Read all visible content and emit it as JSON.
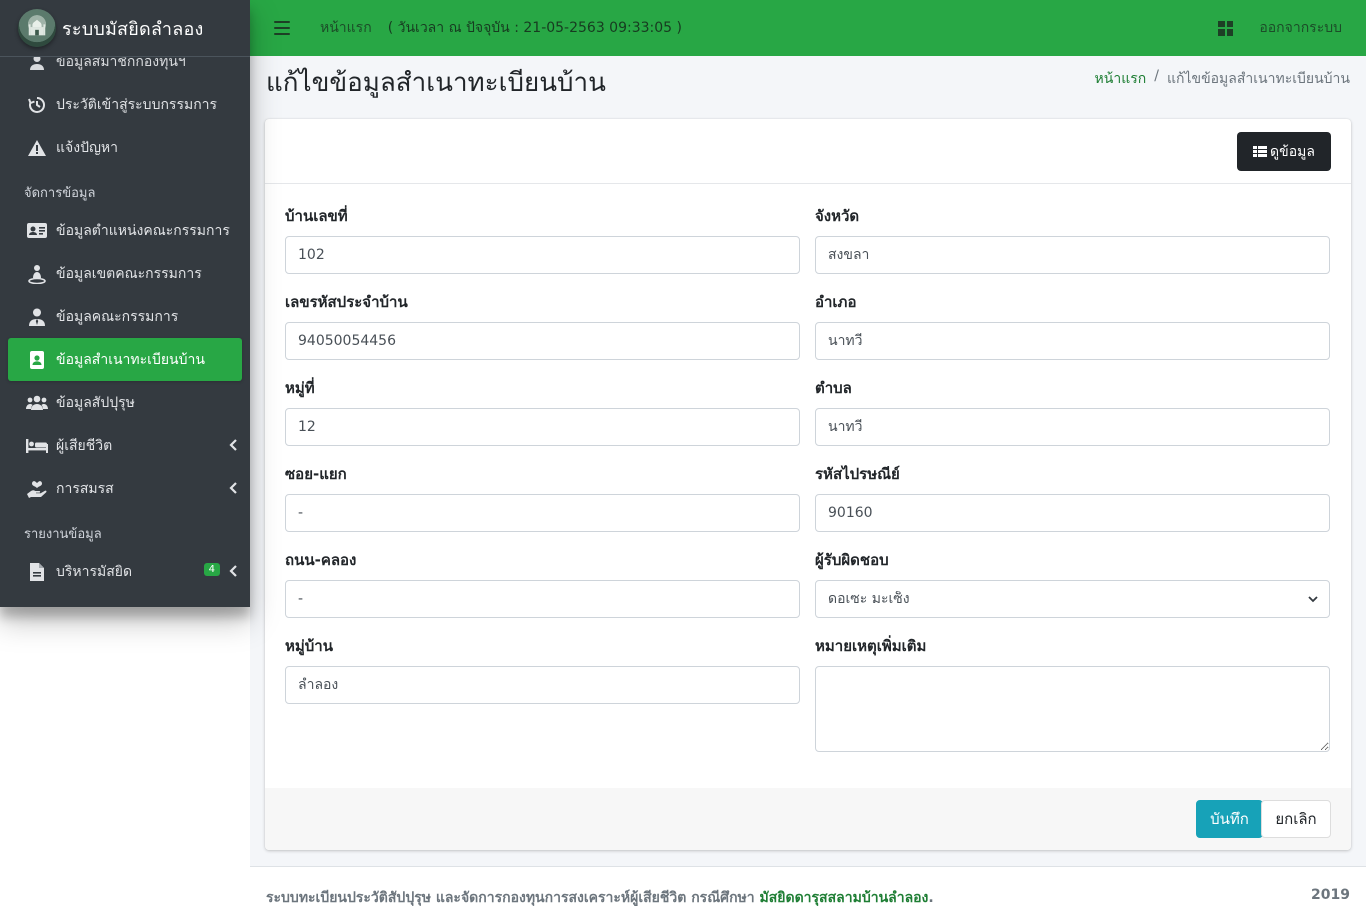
{
  "app": {
    "title": "ระบบมัสยิดลำลอง"
  },
  "sidebar": {
    "items_top": [
      {
        "label": "ข้อมูลสมาชิกกองทุนฯ",
        "icon": "user-icon"
      },
      {
        "label": "ประวัติเข้าสู่ระบบกรรมการ",
        "icon": "history-icon"
      },
      {
        "label": "แจ้งปัญหา",
        "icon": "warning-icon"
      }
    ],
    "header_manage": "จัดการข้อมูล",
    "items_manage": [
      {
        "label": "ข้อมูลตำแหน่งคณะกรรมการ",
        "icon": "id-card-icon"
      },
      {
        "label": "ข้อมูลเขตคณะกรรมการ",
        "icon": "map-marker-user-icon"
      },
      {
        "label": "ข้อมูลคณะกรรมการ",
        "icon": "user-tie-icon"
      },
      {
        "label": "ข้อมูลสำเนาทะเบียนบ้าน",
        "icon": "address-book-icon",
        "active": true
      },
      {
        "label": "ข้อมูลสัปปุรุษ",
        "icon": "users-icon"
      },
      {
        "label": "ผู้เสียชีวิต",
        "icon": "bed-icon",
        "caret": true
      },
      {
        "label": "การสมรส",
        "icon": "hand-holding-heart-icon",
        "caret": true
      }
    ],
    "header_report": "รายงานข้อมูล",
    "items_report": [
      {
        "label": "บริหารมัสยิด",
        "icon": "file-icon",
        "badge": "4",
        "caret": true
      }
    ]
  },
  "topbar": {
    "home": "หน้าแรก",
    "datetime": "( วันเวลา ณ ปัจจุบัน : 21-05-2563 09:33:05 )",
    "logout": "ออกจากระบบ"
  },
  "page": {
    "title": "แก้ไขข้อมูลสำเนาทะเบียนบ้าน",
    "breadcrumb_home": "หน้าแรก",
    "breadcrumb_current": "แก้ไขข้อมูลสำเนาทะเบียนบ้าน",
    "view_button": "ดูข้อมูล"
  },
  "form": {
    "house_no": {
      "label": "บ้านเลขที่",
      "value": "102"
    },
    "house_code": {
      "label": "เลขรหัสประจำบ้าน",
      "value": "94050054456"
    },
    "moo": {
      "label": "หมู่ที่",
      "value": "12"
    },
    "soi": {
      "label": "ซอย-แยก",
      "value": "-"
    },
    "road": {
      "label": "ถนน-คลอง",
      "value": "-"
    },
    "village": {
      "label": "หมู่บ้าน",
      "value": "ลำลอง"
    },
    "province": {
      "label": "จังหวัด",
      "value": "สงขลา"
    },
    "district": {
      "label": "อำเภอ",
      "value": "นาทวี"
    },
    "subdistrict": {
      "label": "ตำบล",
      "value": "นาทวี"
    },
    "postcode": {
      "label": "รหัสไปรษณีย์",
      "value": "90160"
    },
    "responsible": {
      "label": "ผู้รับผิดชอบ",
      "value": "ดอเซะ มะเซ็ง"
    },
    "note": {
      "label": "หมายเหตุเพิ่มเติม",
      "value": ""
    },
    "save_label": "บันทึก",
    "cancel_label": "ยกเลิก"
  },
  "footer": {
    "text": "ระบบทะเบียนประวัติสัปปุรุษ และจัดการกองทุนการสงเคราะห์ผู้เสียชีวิต กรณีศึกษา",
    "link": "มัสยิดดารุสสลามบ้านลำลอง",
    "period": ".",
    "year": "2019"
  }
}
